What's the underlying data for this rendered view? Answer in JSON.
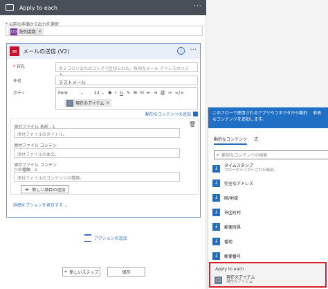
{
  "loop": {
    "title": "Apply to each",
    "output_label": "以前の手順から出力を選択",
    "output_tag": "配列変数",
    "tag_icon": "{x}"
  },
  "mail": {
    "title": "メールの送信 (V2)",
    "to_label": "宛先",
    "to_placeholder": "セミコロンまたはコンマで区切られた、有効なメール アドレスのリスト。",
    "subject_label": "件名",
    "subject_value": "テストメール",
    "body_label": "ボディ",
    "font_label": "Font",
    "font_size": "12",
    "bold": "B",
    "italic": "I",
    "underline": "U",
    "body_tag": "現在のアイテム",
    "dynamic_link": "動的なコンテンツの追加",
    "attach_name_label": "添付ファイル 名前 - 1",
    "attach_name_placeholder": "添付ファイルのタイトル。",
    "attach_content_label": "添付ファイル コンテン",
    "attach_content_placeholder": "添付ファイルの本文。",
    "attach_type_label": "添付ファイル コンテン",
    "attach_type_sub": "ツの種類 - 1",
    "attach_type_placeholder": "添付ファイルのコンテンツの種類。",
    "add_item_button": "新しい項目の追加",
    "advanced_link": "詳細オプションを表示する"
  },
  "add_action": "アクションの追加",
  "new_step": "新しいステップ",
  "save": "保存",
  "panel": {
    "header_text_1": "このフローで使用されるアプリやコネクタから動的",
    "header_text_2": "なコンテンツを追加します。",
    "header_extra": "非表",
    "tab_dynamic": "動的なコンテンツ",
    "tab_expression": "式",
    "search_placeholder": "動的なコンテンツの検索",
    "items": [
      {
        "label": "タイムスタンプ",
        "sub": "フローがトリガーされた時刻。"
      },
      {
        "label": "完全なアドレス",
        "sub": ""
      },
      {
        "label": "国/地域",
        "sub": ""
      },
      {
        "label": "市区町村",
        "sub": ""
      },
      {
        "label": "郵便府県",
        "sub": ""
      },
      {
        "label": "番地",
        "sub": ""
      },
      {
        "label": "郵便番号",
        "sub": ""
      }
    ],
    "apply_section_title": "Apply to each",
    "apply_item_label": "現在のアイテム",
    "apply_item_sub": "現在のアイテム"
  },
  "colors": {
    "header_dark": "#484f58",
    "accent_blue": "#1f6fc5",
    "highlight_red": "#d42027",
    "outlook_red": "#c8102e"
  }
}
